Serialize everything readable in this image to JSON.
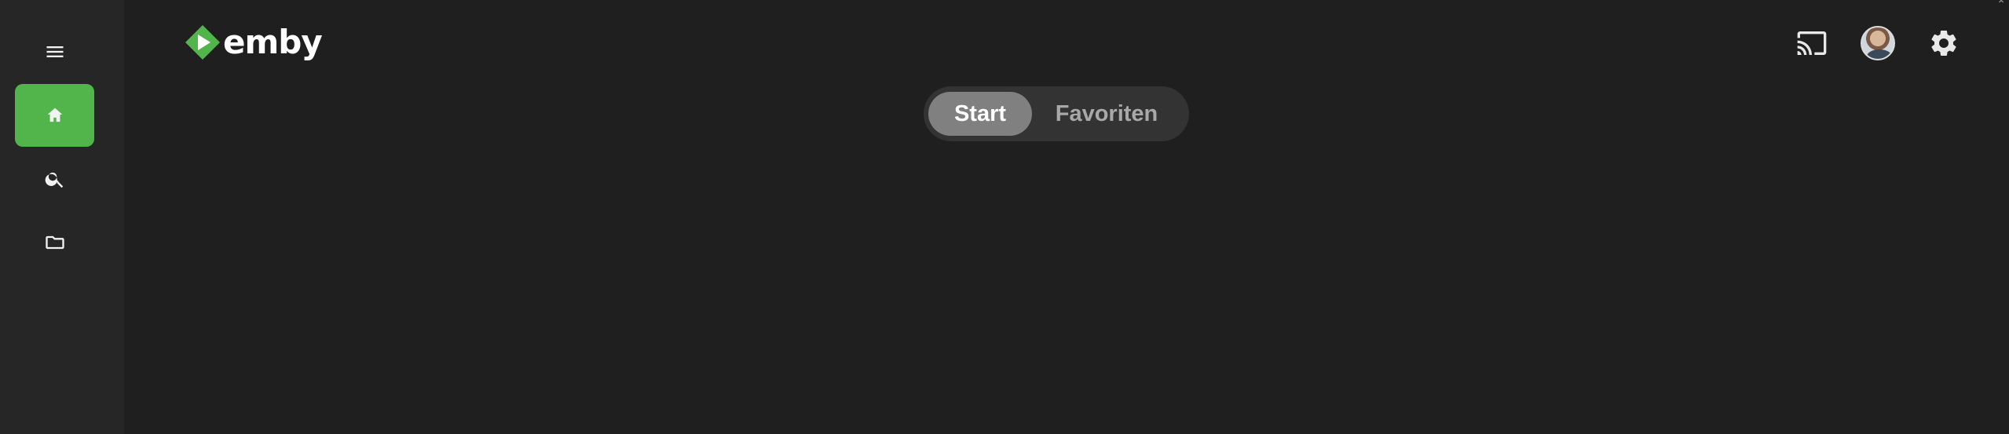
{
  "app": {
    "name": "emby"
  },
  "sidebar": {
    "items": [
      {
        "id": "menu",
        "icon": "menu-icon"
      },
      {
        "id": "home",
        "icon": "home-icon",
        "active": true
      },
      {
        "id": "search",
        "icon": "search-icon"
      },
      {
        "id": "folder",
        "icon": "folder-icon"
      }
    ]
  },
  "tabs": [
    {
      "label": "Start",
      "active": true
    },
    {
      "label": "Favoriten",
      "active": false
    }
  ],
  "header": {
    "actions": [
      {
        "id": "cast",
        "icon": "cast-icon"
      },
      {
        "id": "avatar",
        "icon": "user-avatar"
      },
      {
        "id": "settings",
        "icon": "gear-icon"
      }
    ]
  },
  "colors": {
    "accent": "#52b54b",
    "background": "#1f1f1f",
    "sidebar": "#262626",
    "tab_bar": "#333333",
    "tab_active": "#808080"
  }
}
